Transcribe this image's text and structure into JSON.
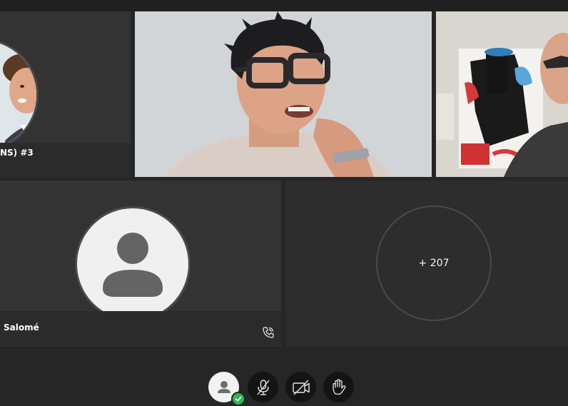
{
  "participants": {
    "tile1": {
      "name": "NS) #3"
    },
    "tile4": {
      "name": "Salomé"
    },
    "overflow": {
      "count_label": "+ 207"
    }
  },
  "controls": {
    "profile": {
      "icon": "user-status-icon",
      "status": "available"
    },
    "mic": {
      "icon": "mic-muted-icon"
    },
    "camera": {
      "icon": "camera-off-icon"
    },
    "hand": {
      "icon": "raise-hand-icon"
    }
  },
  "colors": {
    "background": "#262626",
    "tile": "#333333",
    "namebar": "#2b2b2b",
    "status_green": "#2bb55a",
    "button_dark": "#141414"
  }
}
